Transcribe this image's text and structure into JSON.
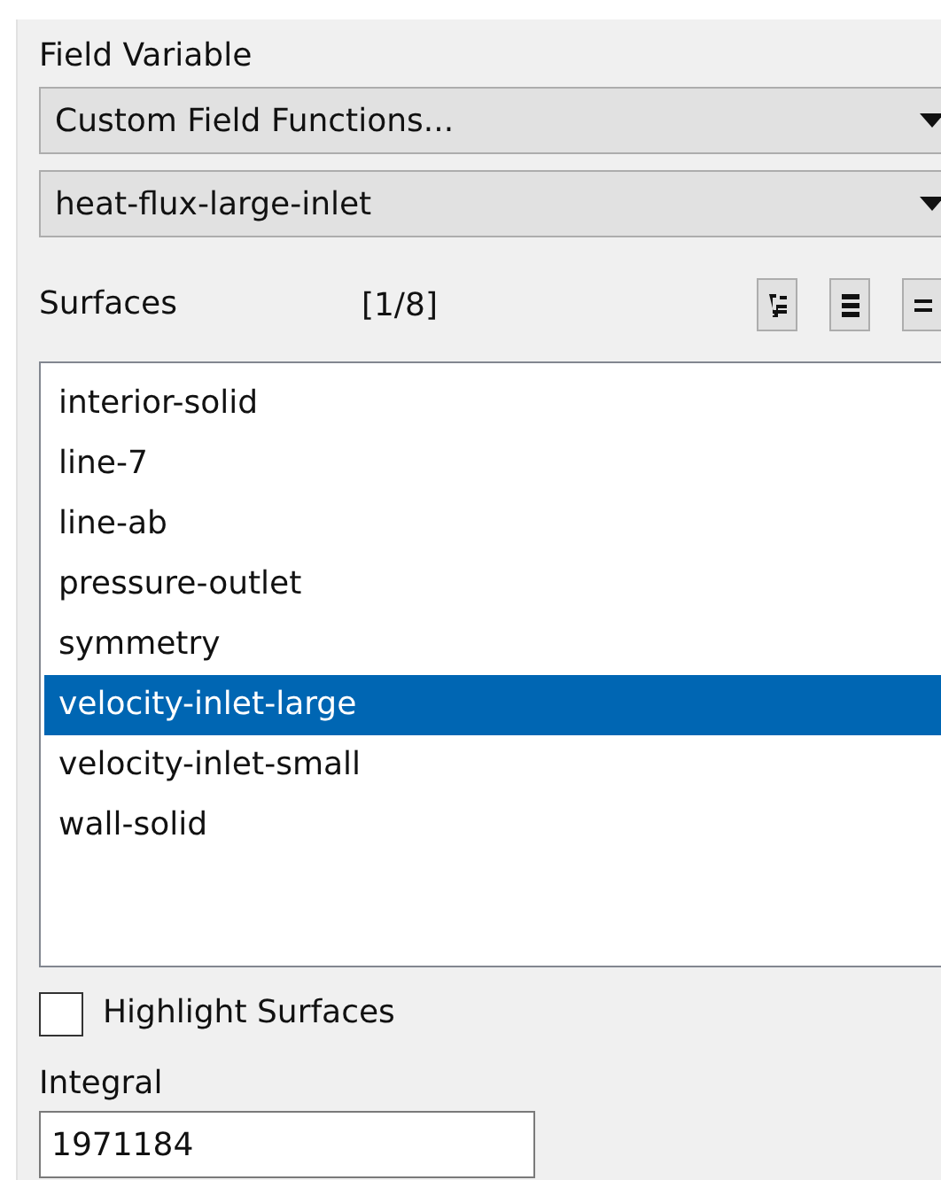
{
  "field_variable": {
    "label": "Field Variable",
    "category": "Custom Field Functions...",
    "function": "heat-flux-large-inlet"
  },
  "surfaces": {
    "label": "Surfaces",
    "count": "[1/8]",
    "items": [
      {
        "name": "interior-solid",
        "selected": false
      },
      {
        "name": "line-7",
        "selected": false
      },
      {
        "name": "line-ab",
        "selected": false
      },
      {
        "name": "pressure-outlet",
        "selected": false
      },
      {
        "name": "symmetry",
        "selected": false
      },
      {
        "name": "velocity-inlet-large",
        "selected": true
      },
      {
        "name": "velocity-inlet-small",
        "selected": false
      },
      {
        "name": "wall-solid",
        "selected": false
      }
    ]
  },
  "highlight_surfaces": {
    "label": "Highlight Surfaces",
    "checked": false
  },
  "integral": {
    "label": "Integral",
    "value": "1971184"
  }
}
